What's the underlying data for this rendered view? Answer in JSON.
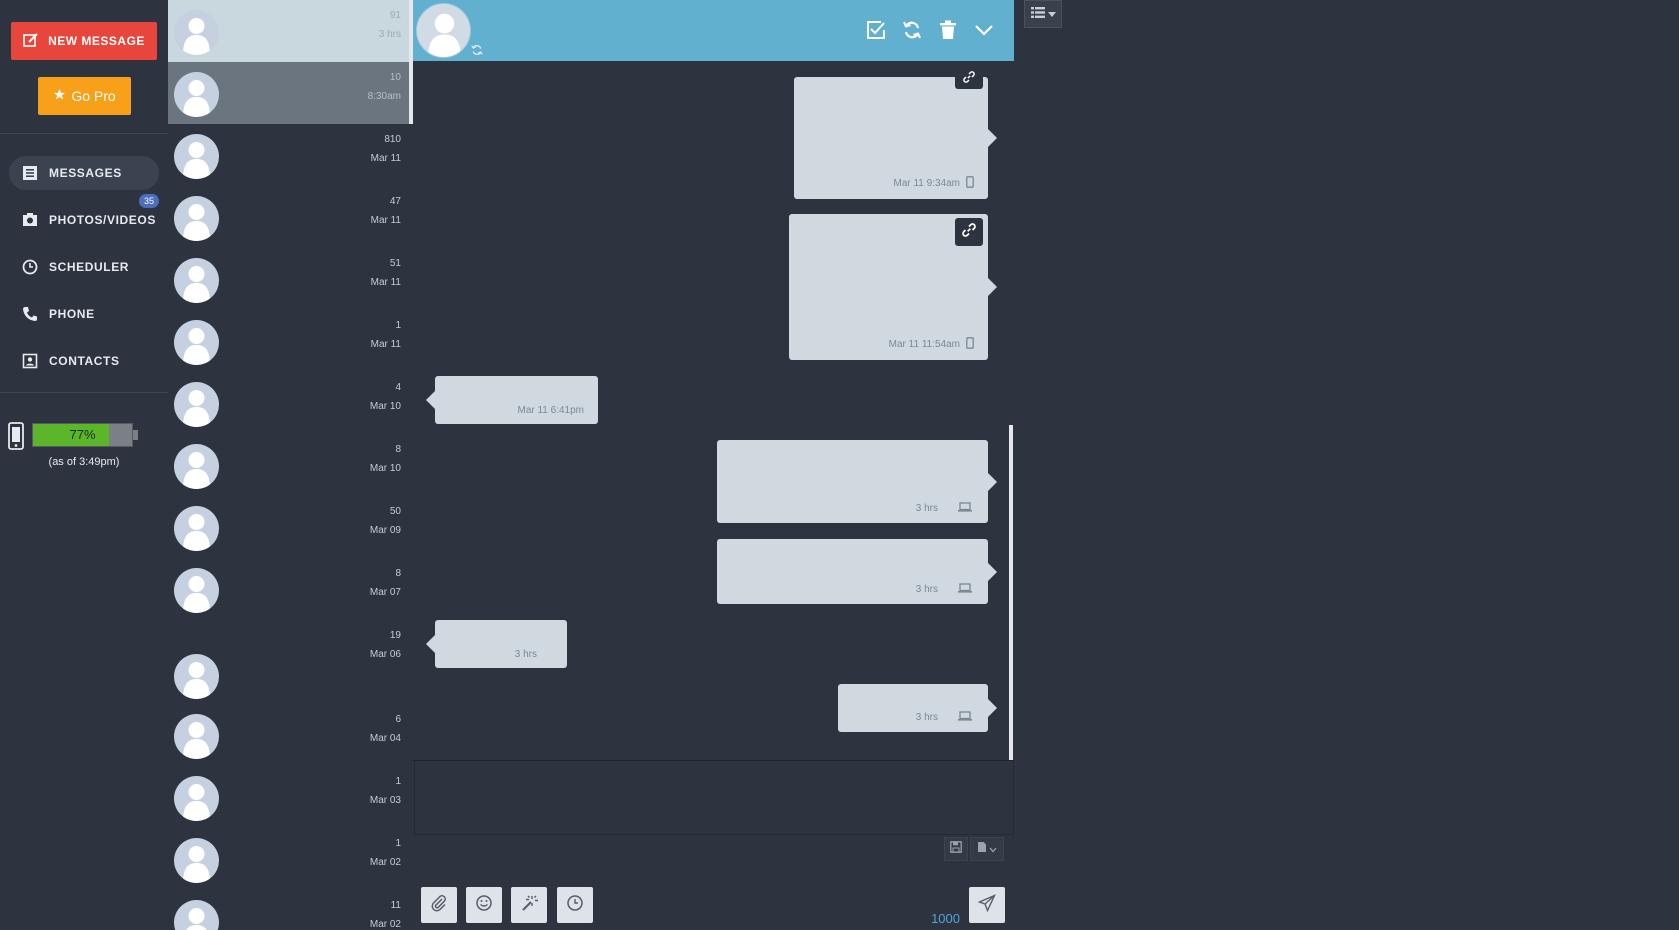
{
  "nav": {
    "new_message_label": "NEW MESSAGE",
    "go_pro_label": "Go Pro",
    "items": [
      {
        "label": "MESSAGES",
        "icon": "messages-icon",
        "active": true
      },
      {
        "label": "PHOTOS/VIDEOS",
        "icon": "camera-icon",
        "badge": "35"
      },
      {
        "label": "SCHEDULER",
        "icon": "clock-icon"
      },
      {
        "label": "PHONE",
        "icon": "phone-icon"
      },
      {
        "label": "CONTACTS",
        "icon": "contacts-icon"
      }
    ],
    "battery": {
      "percent_label": "77%",
      "level": 0.77,
      "as_of": "(as of 3:49pm)"
    }
  },
  "conversations": [
    {
      "count": "91",
      "date": "3 hrs",
      "state": "selected"
    },
    {
      "count": "10",
      "date": "8:30am",
      "state": "hover"
    },
    {
      "count": "810",
      "date": "Mar 11"
    },
    {
      "count": "47",
      "date": "Mar 11"
    },
    {
      "count": "51",
      "date": "Mar 11"
    },
    {
      "count": "1",
      "date": "Mar 11"
    },
    {
      "count": "4",
      "date": "Mar 10"
    },
    {
      "count": "8",
      "date": "Mar 10"
    },
    {
      "count": "50",
      "date": "Mar 09"
    },
    {
      "count": "8",
      "date": "Mar 07"
    },
    {
      "count": "19",
      "date": "Mar 06"
    },
    {
      "count": "6",
      "date": "Mar 04"
    },
    {
      "count": "1",
      "date": "Mar 03"
    },
    {
      "count": "1",
      "date": "Mar 02"
    },
    {
      "count": "11",
      "date": "Mar 02"
    }
  ],
  "messages": [
    {
      "direction": "out",
      "time": "Mar 11 9:34am",
      "device": "phone-icon"
    },
    {
      "direction": "out",
      "time": "Mar 11 11:54am",
      "device": "phone-icon",
      "has_link": true
    },
    {
      "direction": "in",
      "time": "Mar 11 6:41pm"
    },
    {
      "direction": "out",
      "time": "3 hrs",
      "device": "laptop-icon"
    },
    {
      "direction": "out",
      "time": "3 hrs",
      "device": "laptop-icon"
    },
    {
      "direction": "in",
      "time": "3 hrs"
    },
    {
      "direction": "out",
      "time": "3 hrs",
      "device": "laptop-icon"
    }
  ],
  "composer": {
    "placeholder": "",
    "char_count": "1000"
  },
  "colors": {
    "accent_red": "#e8453c",
    "accent_orange": "#f7a11a",
    "header_blue": "#62b0d0",
    "battery_green": "#5cb629",
    "badge_blue": "#4b6fbd"
  }
}
